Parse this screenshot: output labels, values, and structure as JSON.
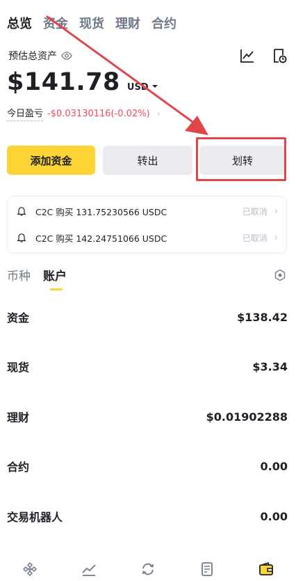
{
  "top_tabs": [
    "总览",
    "资金",
    "现货",
    "理财",
    "合约"
  ],
  "header": {
    "estimated_label": "预估总资产",
    "balance": "$141.78",
    "currency": "USD",
    "pnl_label": "今日盈亏",
    "pnl_value": "-$0.03130116(-0.02%)",
    "pnl_chevron": "›"
  },
  "actions": {
    "add_label": "添加资金",
    "out_label": "转出",
    "transfer_label": "划转"
  },
  "notices": [
    {
      "text": "C2C 购买 131.75230566 USDC",
      "status": "已取消",
      "chevron": "›"
    },
    {
      "text": "C2C 购买 142.24751066 USDC",
      "status": "已取消",
      "chevron": "›"
    }
  ],
  "sub_tabs": [
    "币种",
    "账户"
  ],
  "accounts": [
    {
      "name": "资金",
      "value": "$138.42"
    },
    {
      "name": "现货",
      "value": "$3.34"
    },
    {
      "name": "理财",
      "value": "$0.01902288"
    },
    {
      "name": "合约",
      "value": "0.00"
    },
    {
      "name": "交易机器人",
      "value": "0.00"
    }
  ],
  "icons": {
    "eye": "eye-icon",
    "chart": "chart-icon",
    "history": "history-icon",
    "caret": "caret-down-icon",
    "bell": "bell-icon",
    "hex": "hexagon-settings-icon",
    "nav": [
      "home-icon",
      "markets-icon",
      "trade-icon",
      "futures-icon",
      "wallet-icon"
    ]
  },
  "colors": {
    "accent": "#fcd535",
    "negative": "#f6465d",
    "annotation": "#e0454a"
  }
}
